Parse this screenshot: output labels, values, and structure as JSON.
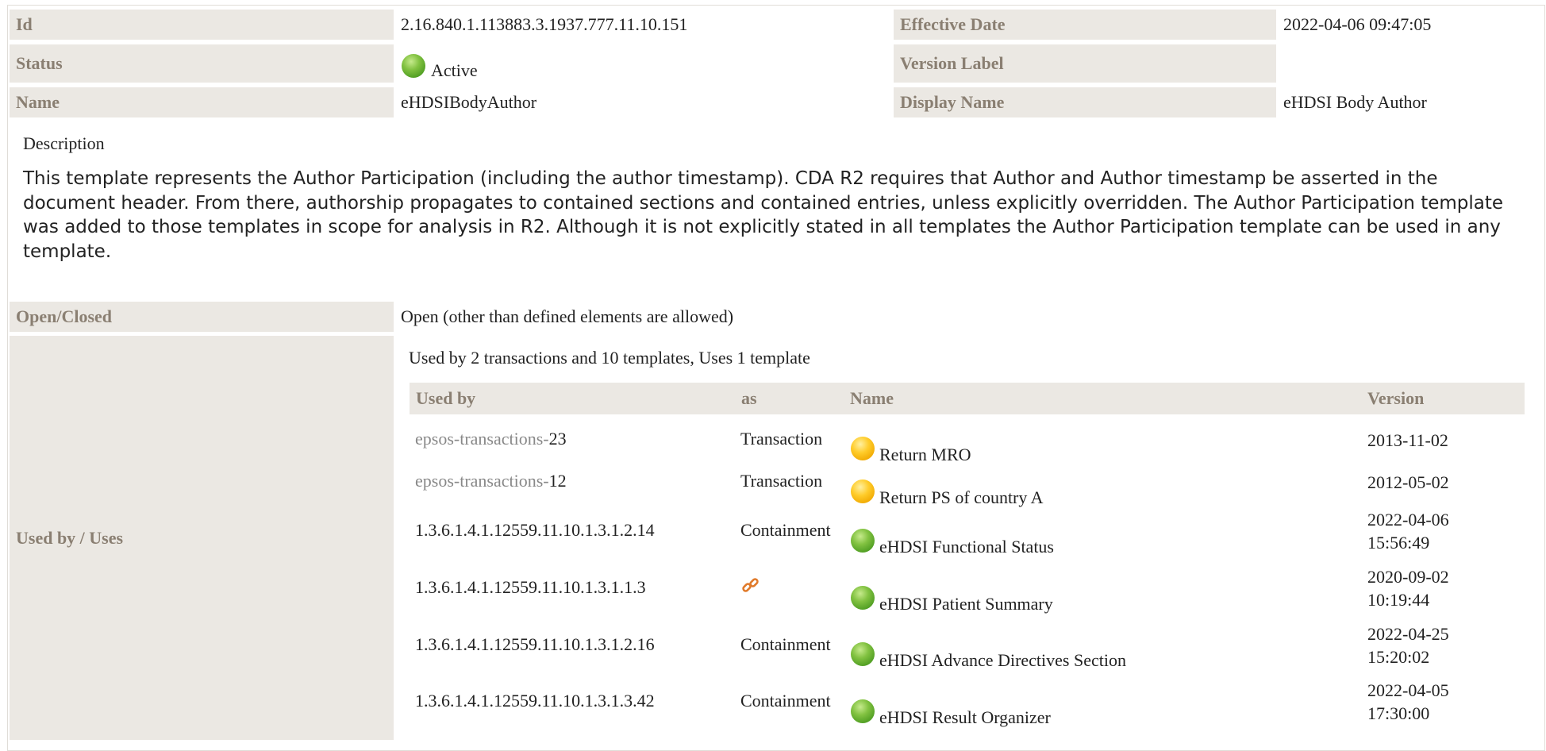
{
  "header": {
    "id": {
      "label": "Id",
      "value": "2.16.840.1.113883.3.1937.777.11.10.151"
    },
    "effective_date": {
      "label": "Effective Date",
      "value": "2022-04-06 09:47:05"
    },
    "status": {
      "label": "Status",
      "value": "Active",
      "icon": "green-status-dot-icon",
      "color": "#6db33f"
    },
    "version_label": {
      "label": "Version Label",
      "value": ""
    },
    "name": {
      "label": "Name",
      "value": "eHDSIBodyAuthor"
    },
    "display_name": {
      "label": "Display Name",
      "value": "eHDSI Body Author"
    }
  },
  "description": {
    "label": "Description",
    "text": "This template represents the Author Participation (including the author timestamp). CDA R2 requires that Author and Author timestamp be asserted in the document header. From there, authorship propagates to contained sections and contained entries, unless explicitly overridden. The Author Participation template was added to those templates in scope for analysis in R2. Although it is not explicitly stated in all templates the Author Participation template can be used in any template."
  },
  "open_closed": {
    "label": "Open/Closed",
    "value": "Open (other than defined elements are allowed)"
  },
  "used_by": {
    "label": "Used by / Uses",
    "summary": "Used by 2 transactions and 10 templates, Uses 1 template",
    "columns": [
      "Used by",
      "as",
      "Name",
      "Version"
    ],
    "rows": [
      {
        "prefix": "epsos-transactions-",
        "id": "23",
        "as": "Transaction",
        "status": "yellow",
        "name": "Return MRO",
        "version": [
          "2013-11-02"
        ]
      },
      {
        "prefix": "epsos-transactions-",
        "id": "12",
        "as": "Transaction",
        "status": "yellow",
        "name": "Return PS of country A",
        "version": [
          "2012-05-02"
        ]
      },
      {
        "prefix": "",
        "id": "1.3.6.1.4.1.12559.11.10.1.3.1.2.14",
        "as": "Containment",
        "status": "green",
        "name": "eHDSI Functional Status",
        "version": [
          "2022-04-06",
          "15:56:49"
        ]
      },
      {
        "prefix": "",
        "id": "1.3.6.1.4.1.12559.11.10.1.3.1.1.3",
        "as": "",
        "as_icon": "link-icon",
        "status": "green",
        "name": "eHDSI Patient Summary",
        "version": [
          "2020-09-02",
          "10:19:44"
        ]
      },
      {
        "prefix": "",
        "id": "1.3.6.1.4.1.12559.11.10.1.3.1.2.16",
        "as": "Containment",
        "status": "green",
        "name": "eHDSI Advance Directives Section",
        "version": [
          "2022-04-25",
          "15:20:02"
        ]
      },
      {
        "prefix": "",
        "id": "1.3.6.1.4.1.12559.11.10.1.3.1.3.42",
        "as": "Containment",
        "status": "green",
        "name": "eHDSI Result Organizer",
        "version": [
          "2022-04-05",
          "17:30:00"
        ]
      }
    ]
  },
  "colors": {
    "label_bg": "#ebe8e3",
    "label_text": "#8a7f72",
    "link_icon": "#e07a2a"
  }
}
